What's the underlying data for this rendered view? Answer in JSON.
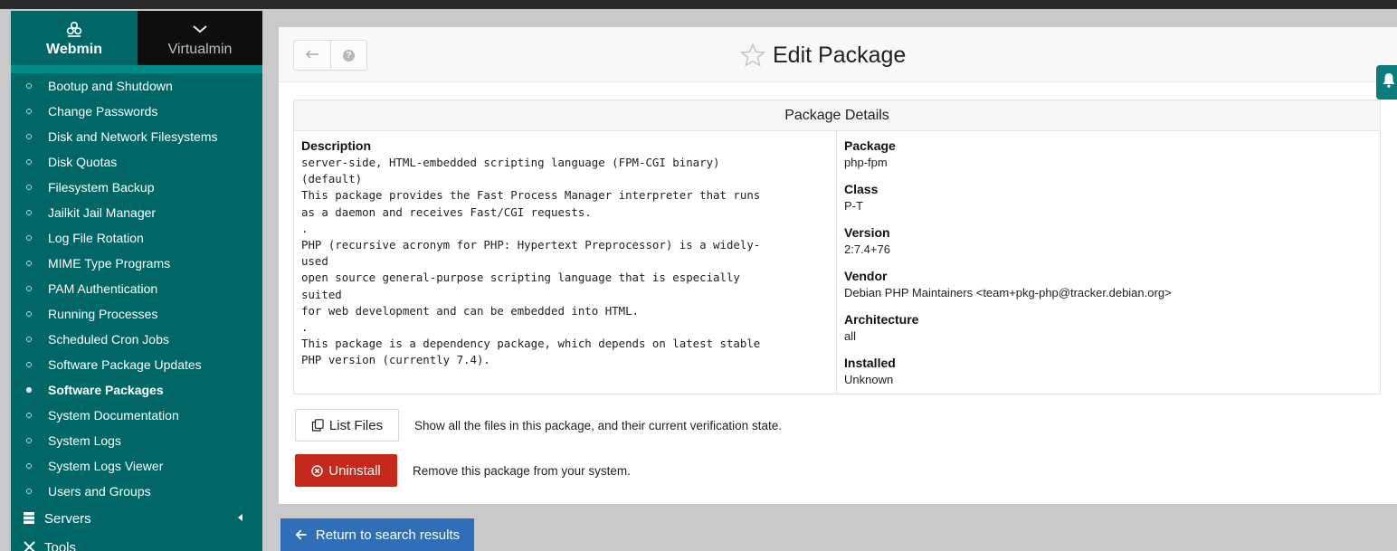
{
  "sidebar": {
    "tabs": [
      {
        "label": "Webmin",
        "icon": "webmin-logo-icon"
      },
      {
        "label": "Virtualmin",
        "icon": "chevron-down-icon"
      }
    ],
    "items": [
      {
        "label": "Bootup and Shutdown"
      },
      {
        "label": "Change Passwords"
      },
      {
        "label": "Disk and Network Filesystems"
      },
      {
        "label": "Disk Quotas"
      },
      {
        "label": "Filesystem Backup"
      },
      {
        "label": "Jailkit Jail Manager"
      },
      {
        "label": "Log File Rotation"
      },
      {
        "label": "MIME Type Programs"
      },
      {
        "label": "PAM Authentication"
      },
      {
        "label": "Running Processes"
      },
      {
        "label": "Scheduled Cron Jobs"
      },
      {
        "label": "Software Package Updates"
      },
      {
        "label": "Software Packages",
        "active": true
      },
      {
        "label": "System Documentation"
      },
      {
        "label": "System Logs"
      },
      {
        "label": "System Logs Viewer"
      },
      {
        "label": "Users and Groups"
      }
    ],
    "groups": [
      {
        "label": "Servers",
        "icon": "server-icon"
      },
      {
        "label": "Tools",
        "icon": "tools-icon"
      }
    ]
  },
  "header": {
    "title": "Edit Package",
    "back_icon": "back-arrow-icon",
    "help_glyph": "?"
  },
  "details": {
    "heading": "Package Details",
    "description_label": "Description",
    "description_text": "server-side, HTML-embedded scripting language (FPM-CGI binary)\n(default)\nThis package provides the Fast Process Manager interpreter that runs\nas a daemon and receives Fast/CGI requests.\n.\nPHP (recursive acronym for PHP: Hypertext Preprocessor) is a widely-\nused\nopen source general-purpose scripting language that is especially\nsuited\nfor web development and can be embedded into HTML.\n.\nThis package is a dependency package, which depends on latest stable\nPHP version (currently 7.4).",
    "fields": [
      {
        "label": "Package",
        "value": "php-fpm"
      },
      {
        "label": "Class",
        "value": "P-T"
      },
      {
        "label": "Version",
        "value": "2:7.4+76"
      },
      {
        "label": "Vendor",
        "value": "Debian PHP Maintainers <team+pkg-php@tracker.debian.org>"
      },
      {
        "label": "Architecture",
        "value": "all"
      },
      {
        "label": "Installed",
        "value": "Unknown"
      }
    ]
  },
  "actions": {
    "list_files": {
      "label": "List Files",
      "description": "Show all the files in this package, and their current verification state."
    },
    "uninstall": {
      "label": "Uninstall",
      "description": "Remove this package from your system."
    }
  },
  "footer": {
    "return_label": "Return to search results"
  },
  "colors": {
    "sidebar": "#006666",
    "active_marker": "#e0008a",
    "danger": "#c4291c",
    "primary": "#2e6fb8"
  }
}
